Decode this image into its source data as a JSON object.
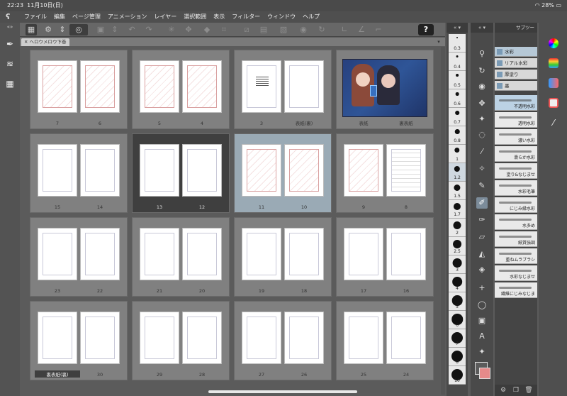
{
  "status": {
    "time": "22:23",
    "date": "11月10日(日)",
    "battery": "28%"
  },
  "menu": [
    "ファイル",
    "編集",
    "ページ管理",
    "アニメーション",
    "レイヤー",
    "選択範囲",
    "表示",
    "フィルター",
    "ウィンドウ",
    "ヘルプ"
  ],
  "toolbar": {
    "help": "?"
  },
  "tab": {
    "label": "ヘロウメロウ下巻"
  },
  "pages": [
    {
      "labels": [
        "7",
        "6"
      ],
      "type": "sketch"
    },
    {
      "labels": [
        "5",
        "4"
      ],
      "type": "sketch"
    },
    {
      "labels": [
        "3",
        "表紙(裏)"
      ],
      "type": "text"
    },
    {
      "labels": [
        "表紙",
        "裏表紙"
      ],
      "type": "cover"
    },
    {
      "labels": [
        "15",
        "14"
      ],
      "type": "blank"
    },
    {
      "labels": [
        "13",
        "12"
      ],
      "type": "blank"
    },
    {
      "labels": [
        "11",
        "10"
      ],
      "type": "sketch"
    },
    {
      "labels": [
        "9",
        "8"
      ],
      "type": "sketch"
    },
    {
      "labels": [
        "23",
        "22"
      ],
      "type": "blank"
    },
    {
      "labels": [
        "21",
        "20"
      ],
      "type": "blank"
    },
    {
      "labels": [
        "19",
        "18"
      ],
      "type": "blank"
    },
    {
      "labels": [
        "17",
        "16"
      ],
      "type": "blank"
    },
    {
      "labels": [
        "裏表紙(裏)",
        "30"
      ],
      "type": "blank"
    },
    {
      "labels": [
        "29",
        "28"
      ],
      "type": "blank"
    },
    {
      "labels": [
        "27",
        "26"
      ],
      "type": "blank"
    },
    {
      "labels": [
        "25",
        "24"
      ],
      "type": "blank"
    }
  ],
  "brush_sizes": [
    "0.3",
    "0.4",
    "0.5",
    "0.6",
    "0.7",
    "0.8",
    "1",
    "1.2",
    "1.5",
    "1.7",
    "2",
    "2.5",
    "3",
    "4",
    "5",
    "6",
    "7",
    "8",
    "10"
  ],
  "subtool": {
    "header": "サブツー",
    "groups": [
      "水彩",
      "リアル水彩",
      "厚塗り",
      "墨"
    ],
    "brushes": [
      "不透明水彩",
      "透明水彩",
      "濃い水彩",
      "滑らか水彩",
      "塗り&なじませ",
      "水彩毛筆",
      "にじみ縁水彩",
      "水多め",
      "紙質強調",
      "重ねムラブラシ",
      "水彩なじませ",
      "繊維にじみなじま"
    ]
  },
  "colors": {
    "main": "#5b5b5b",
    "sub": "#e58a8a"
  }
}
